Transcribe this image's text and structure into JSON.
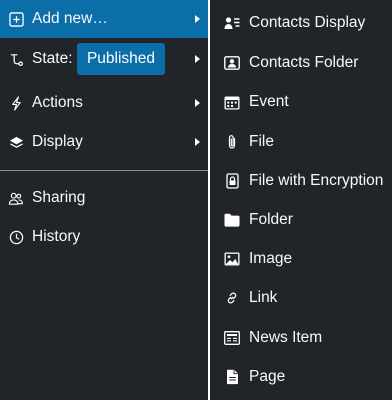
{
  "left_menu": {
    "items": [
      {
        "label": "Add new…",
        "icon": "plus-square-icon",
        "has_submenu": true,
        "active": true
      },
      {
        "label": "State:",
        "icon": "workflow-icon",
        "has_submenu": true,
        "badge": "Published"
      },
      {
        "label": "Actions",
        "icon": "lightning-icon",
        "has_submenu": true
      },
      {
        "label": "Display",
        "icon": "layers-icon",
        "has_submenu": true
      },
      {
        "label": "Sharing",
        "icon": "people-icon",
        "has_submenu": false
      },
      {
        "label": "History",
        "icon": "clock-icon",
        "has_submenu": false
      }
    ]
  },
  "add_new_submenu": {
    "items": [
      {
        "label": "Contacts Display",
        "icon": "contacts-display-icon"
      },
      {
        "label": "Contacts Folder",
        "icon": "contacts-folder-icon"
      },
      {
        "label": "Event",
        "icon": "calendar-event-icon"
      },
      {
        "label": "File",
        "icon": "paperclip-icon"
      },
      {
        "label": "File with Encryption",
        "icon": "lock-file-icon"
      },
      {
        "label": "Folder",
        "icon": "folder-icon"
      },
      {
        "label": "Image",
        "icon": "image-icon"
      },
      {
        "label": "Link",
        "icon": "link-icon"
      },
      {
        "label": "News Item",
        "icon": "newspaper-icon"
      },
      {
        "label": "Page",
        "icon": "page-icon"
      }
    ]
  },
  "colors": {
    "menu_bg": "#212529",
    "accent": "#0b6ea8",
    "text": "#f8f9fa",
    "divider": "#8a8f95"
  }
}
